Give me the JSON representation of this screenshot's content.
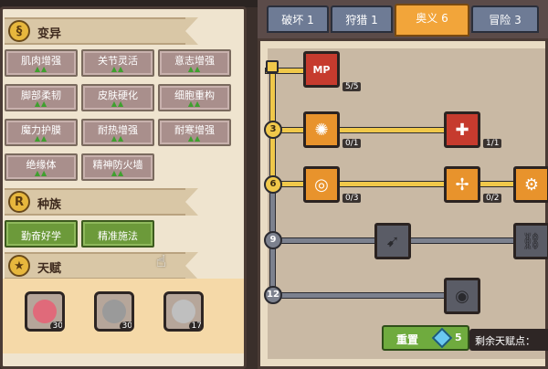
{
  "sections": {
    "mutation": {
      "title": "变异",
      "icon": "dna-icon"
    },
    "race": {
      "title": "种族",
      "icon": "r-badge-icon"
    },
    "talent": {
      "title": "天赋",
      "icon": "star-icon"
    }
  },
  "mutation_buttons": [
    {
      "label": "肌肉增强",
      "arrows": "▲▲"
    },
    {
      "label": "关节灵活",
      "arrows": "▲▲"
    },
    {
      "label": "意志增强",
      "arrows": "▲▲"
    },
    {
      "label": "脚部柔韧",
      "arrows": "▲▲"
    },
    {
      "label": "皮肤硬化",
      "arrows": "▲▲"
    },
    {
      "label": "细胞重构",
      "arrows": "▲▲"
    },
    {
      "label": "魔力护膜",
      "arrows": "▲▲"
    },
    {
      "label": "耐热增强",
      "arrows": "▲▲"
    },
    {
      "label": "耐寒增强",
      "arrows": "▲▲"
    },
    {
      "label": "绝缘体",
      "arrows": "▲▲"
    },
    {
      "label": "精神防火墙",
      "arrows": "▲▲"
    }
  ],
  "race_buttons": [
    {
      "label": "勤奋好学"
    },
    {
      "label": "精准施法"
    }
  ],
  "talent_portraits": [
    {
      "level": "30",
      "color": "#e06a7a"
    },
    {
      "level": "30",
      "color": "#9a9a9a"
    },
    {
      "level": "17",
      "color": "#bfbfbf"
    }
  ],
  "tabs": [
    {
      "label": "破坏 1",
      "active": false
    },
    {
      "label": "狩猎 1",
      "active": false
    },
    {
      "label": "奥义 6",
      "active": true
    },
    {
      "label": "冒险 3",
      "active": false
    }
  ],
  "tree": {
    "levels": [
      "3",
      "6",
      "9",
      "12"
    ],
    "nodes": [
      {
        "name": "mp-node",
        "icon": "MP",
        "count": "5/5",
        "style": "red"
      },
      {
        "name": "swirl-node",
        "icon": "✺",
        "count": "0/1",
        "style": "orange"
      },
      {
        "name": "hand-cross-node",
        "icon": "✚",
        "count": "1/1",
        "style": "red"
      },
      {
        "name": "spiral-node",
        "icon": "◎",
        "count": "0/3",
        "style": "orange"
      },
      {
        "name": "cross-arrow-node",
        "icon": "✢",
        "count": "0/2",
        "style": "orange"
      },
      {
        "name": "gear-node",
        "icon": "⚙",
        "count": "",
        "style": "orange"
      },
      {
        "name": "locked-spike-node",
        "icon": "➹",
        "count": "",
        "style": "dark"
      },
      {
        "name": "locked-chain-node",
        "icon": "⛓",
        "count": "",
        "style": "dark"
      },
      {
        "name": "locked-vortex-node",
        "icon": "◉",
        "count": "",
        "style": "dark"
      }
    ]
  },
  "footer": {
    "reset_label": "重置",
    "reset_cost": "5",
    "remaining_label": "剩余天赋点："
  }
}
